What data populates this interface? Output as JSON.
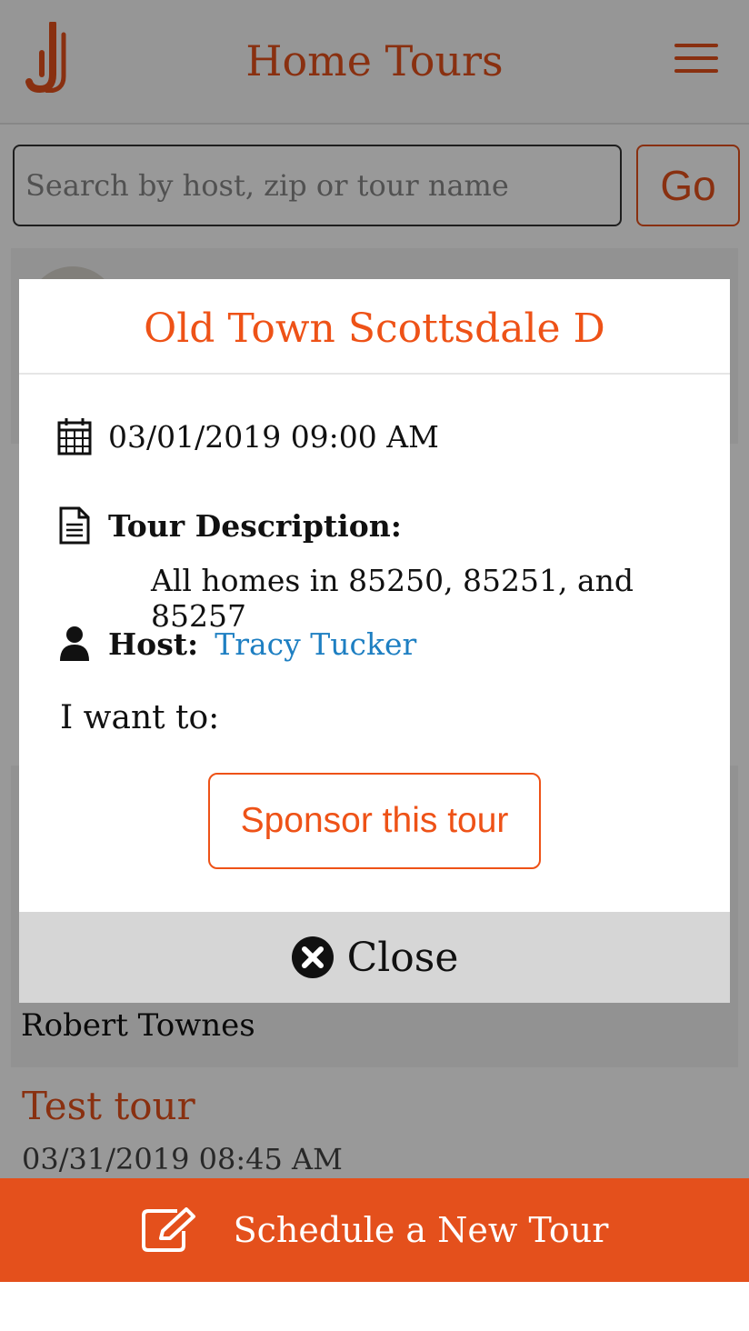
{
  "header": {
    "title": "Home Tours",
    "logo_icon": "logo-icon",
    "menu_icon": "hamburger-menu-icon"
  },
  "search": {
    "placeholder": "Search by host, zip or tour name",
    "value": "",
    "go_label": "Go"
  },
  "list": {
    "card_host": "Robert Townes",
    "next_title": "Test tour",
    "next_date": "03/31/2019 08:45 AM"
  },
  "footer": {
    "label": "Schedule a New Tour",
    "icon": "edit-icon"
  },
  "modal": {
    "title": "Old Town Scottsdale D",
    "date": "03/01/2019 09:00 AM",
    "description_label": "Tour Description:",
    "description": "All homes in 85250, 85251, and 85257",
    "host_label": "Host:",
    "host_name": "Tracy Tucker",
    "want_label": "I want to:",
    "sponsor_label": "Sponsor this tour",
    "close_label": "Close"
  },
  "colors": {
    "accent": "#e4501c",
    "link": "#1e7fc2",
    "close_bar": "#d6d6d6"
  }
}
